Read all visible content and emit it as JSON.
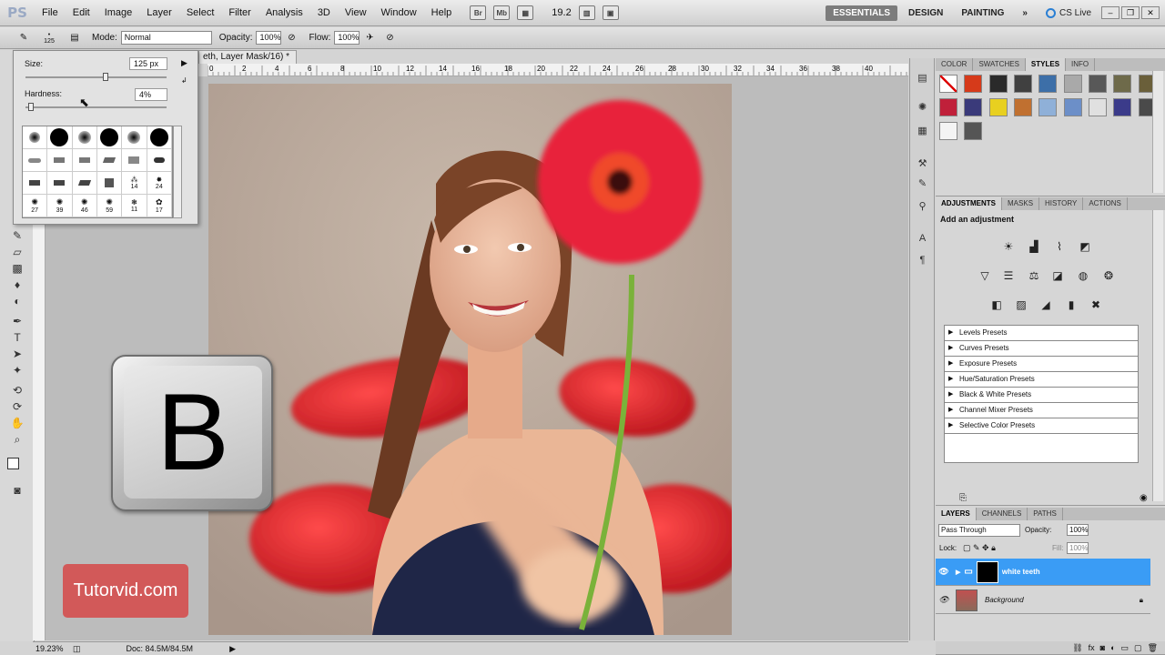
{
  "app": {
    "logo": "PS"
  },
  "menu": {
    "items": [
      "File",
      "Edit",
      "Image",
      "Layer",
      "Select",
      "Filter",
      "Analysis",
      "3D",
      "View",
      "Window",
      "Help"
    ]
  },
  "menubar": {
    "br_icon": "Br",
    "mb_icon": "Mb",
    "zoom": "19.2",
    "workspaces": [
      "ESSENTIALS",
      "DESIGN",
      "PAINTING"
    ],
    "more": "»",
    "cslive": "CS Live",
    "win_controls": [
      "–",
      "❐",
      "✕"
    ]
  },
  "options": {
    "brush_size": "125",
    "mode_label": "Mode:",
    "mode_value": "Normal",
    "opacity_label": "Opacity:",
    "opacity_value": "100%",
    "flow_label": "Flow:",
    "flow_value": "100%"
  },
  "doc": {
    "tab_title": "eth, Layer Mask/16) *",
    "close": "×",
    "ruler_ticks": [
      "0",
      "2",
      "4",
      "6",
      "8",
      "10",
      "12",
      "14",
      "16",
      "18",
      "20",
      "22",
      "24",
      "26",
      "28",
      "30",
      "32",
      "34",
      "36",
      "38",
      "40"
    ]
  },
  "brush_popup": {
    "size_label": "Size:",
    "size_value": "125 px",
    "hardness_label": "Hardness:",
    "hardness_value": "4%",
    "brush_numbers": [
      "14",
      "24",
      "27",
      "39",
      "46",
      "59",
      "11",
      "17"
    ]
  },
  "key_badge": {
    "letter": "B"
  },
  "watermark": {
    "text": "Tutorvid.com"
  },
  "status": {
    "zoom": "19.23%",
    "doc": "Doc: 84.5M/84.5M"
  },
  "styles_panel": {
    "tabs": [
      "COLOR",
      "SWATCHES",
      "STYLES",
      "INFO"
    ],
    "active": "STYLES",
    "swatch_colors": [
      "#ffffff",
      "#d63a1a",
      "#2a2a2a",
      "#404040",
      "#3d6fa8",
      "#a9a9a9",
      "#585858",
      "#6e6a4a",
      "#6a5f3a",
      "#c0203a",
      "#3a3a7a",
      "#e8d020",
      "#c07030",
      "#8fb0d8",
      "#6c8fc8",
      "#e0e0e0",
      "#3b3b8a",
      "#4a4a4a",
      "#f4f4f4",
      "#555555"
    ]
  },
  "adjust_panel": {
    "tabs": [
      "ADJUSTMENTS",
      "MASKS",
      "HISTORY",
      "ACTIONS"
    ],
    "active": "ADJUSTMENTS",
    "heading": "Add an adjustment",
    "presets": [
      "Levels Presets",
      "Curves Presets",
      "Exposure Presets",
      "Hue/Saturation Presets",
      "Black & White Presets",
      "Channel Mixer Presets",
      "Selective Color Presets"
    ]
  },
  "layers_panel": {
    "tabs": [
      "LAYERS",
      "CHANNELS",
      "PATHS"
    ],
    "active": "LAYERS",
    "blend": "Pass Through",
    "opacity_label": "Opacity:",
    "opacity": "100%",
    "lock_label": "Lock:",
    "fill_label": "Fill:",
    "fill": "100%",
    "layers": [
      {
        "name": "white teeth",
        "selected": true
      },
      {
        "name": "Background",
        "selected": false
      }
    ]
  },
  "colors": {
    "accent": "#3a9cf5",
    "flower_red": "#e8213a",
    "chair_red": "#e01e24"
  }
}
